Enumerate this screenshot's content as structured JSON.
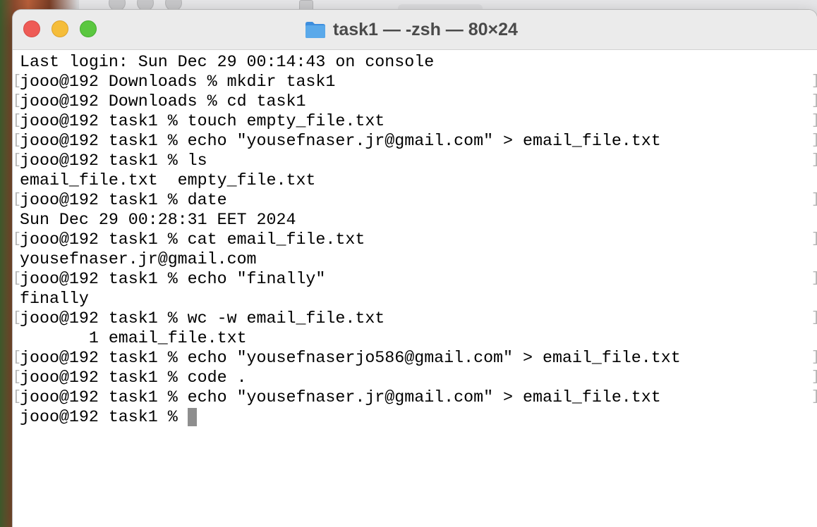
{
  "window": {
    "title": "task1 — -zsh — 80×24"
  },
  "terminal": {
    "lines": [
      {
        "text": "Last login: Sun Dec 29 00:14:43 on console",
        "brackets": false
      },
      {
        "text": "jooo@192 Downloads % mkdir task1",
        "brackets": true
      },
      {
        "text": "jooo@192 Downloads % cd task1",
        "brackets": true
      },
      {
        "text": "jooo@192 task1 % touch empty_file.txt",
        "brackets": true
      },
      {
        "text": "jooo@192 task1 % echo \"yousefnaser.jr@gmail.com\" > email_file.txt",
        "brackets": true
      },
      {
        "text": "jooo@192 task1 % ls",
        "brackets": true
      },
      {
        "text": "email_file.txt  empty_file.txt",
        "brackets": false
      },
      {
        "text": "jooo@192 task1 % date",
        "brackets": true
      },
      {
        "text": "Sun Dec 29 00:28:31 EET 2024",
        "brackets": false
      },
      {
        "text": "jooo@192 task1 % cat email_file.txt",
        "brackets": true
      },
      {
        "text": "yousefnaser.jr@gmail.com",
        "brackets": false
      },
      {
        "text": "jooo@192 task1 % echo \"finally\"",
        "brackets": true
      },
      {
        "text": "finally",
        "brackets": false
      },
      {
        "text": "jooo@192 task1 % wc -w email_file.txt",
        "brackets": true
      },
      {
        "text": "       1 email_file.txt",
        "brackets": false
      },
      {
        "text": "jooo@192 task1 % echo \"yousefnaserjo586@gmail.com\" > email_file.txt",
        "brackets": true
      },
      {
        "text": "jooo@192 task1 % code .",
        "brackets": true
      },
      {
        "text": "jooo@192 task1 % echo \"yousefnaser.jr@gmail.com\" > email_file.txt",
        "brackets": true
      }
    ],
    "prompt": "jooo@192 task1 % "
  },
  "icons": {
    "title": "folder-icon",
    "close": "close-icon",
    "minimize": "minimize-icon",
    "zoom": "zoom-icon"
  },
  "colors": {
    "close": "#ee5b56",
    "minimize": "#f5bd3a",
    "zoom": "#5ac73f",
    "folder": "#5aa9ea"
  }
}
